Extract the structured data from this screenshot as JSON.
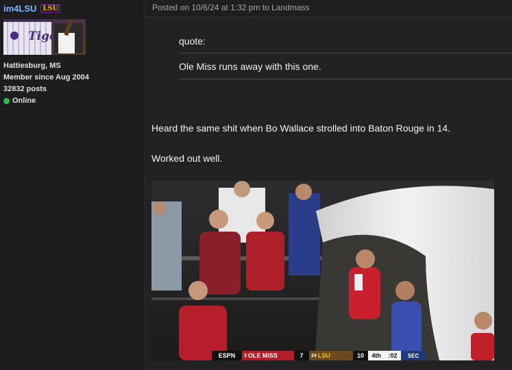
{
  "user": {
    "username": "im4LSU",
    "team_tag": "LSU",
    "location": "Hattiesburg, MS",
    "member_since": "Member since Aug 2004",
    "posts": "32832 posts",
    "status": "Online",
    "avatar_text": "Tiger"
  },
  "post": {
    "header": "Posted on 10/6/24 at 1:32 pm to Landmass",
    "quote_label": "quote:",
    "quote_text": "Ole Miss runs away with this one.",
    "line1": "Heard the same shit when Bo Wallace strolled into Baton Rouge in 14.",
    "line2": "Worked out well."
  },
  "gif": {
    "network": "ESPN",
    "team1_rank": "3",
    "team1": "OLE MISS",
    "team1_score": "7",
    "team2_rank": "24",
    "team2": "LSU",
    "team2_score": "10",
    "quarter": "4th",
    "clock": ":02",
    "conference": "SEC"
  },
  "colors": {
    "background": "#1d1d1d",
    "post_background": "#222222",
    "username": "#7fb7ff",
    "online": "#2fb84d"
  }
}
